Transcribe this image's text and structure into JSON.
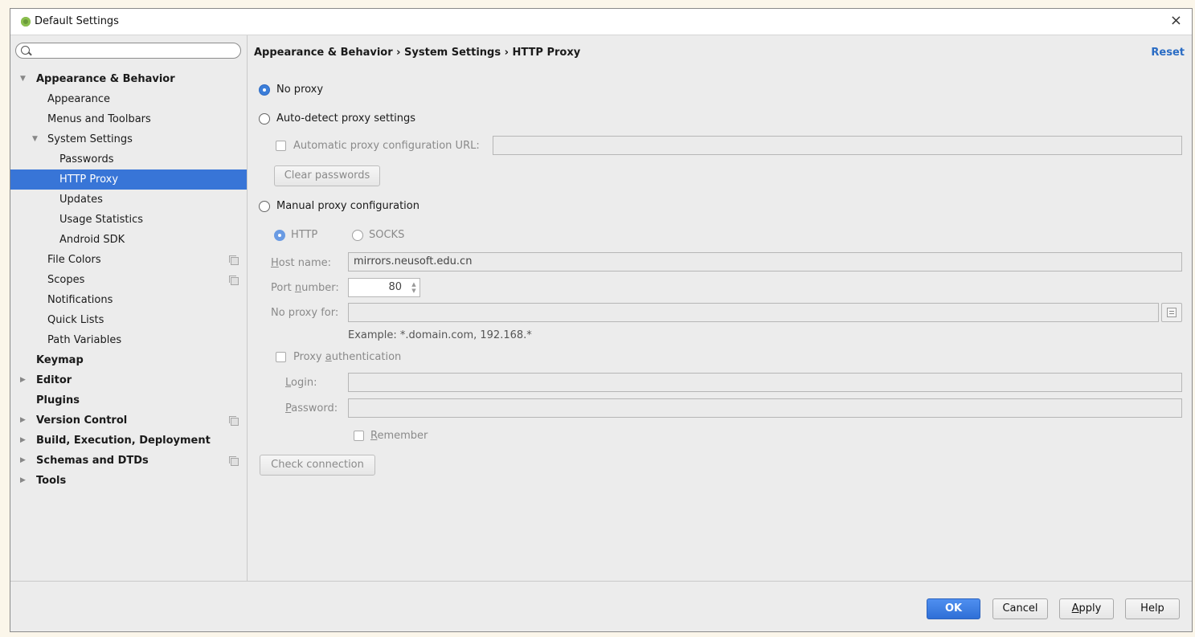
{
  "window": {
    "title": "Default Settings",
    "close_label": "×"
  },
  "search": {
    "placeholder": "",
    "value": ""
  },
  "tree": [
    {
      "label": "Appearance & Behavior",
      "level": 0,
      "expanded": true,
      "bold": true
    },
    {
      "label": "Appearance",
      "level": 1
    },
    {
      "label": "Menus and Toolbars",
      "level": 1
    },
    {
      "label": "System Settings",
      "level": 1,
      "expanded": true
    },
    {
      "label": "Passwords",
      "level": 2
    },
    {
      "label": "HTTP Proxy",
      "level": 2,
      "selected": true
    },
    {
      "label": "Updates",
      "level": 2
    },
    {
      "label": "Usage Statistics",
      "level": 2
    },
    {
      "label": "Android SDK",
      "level": 2
    },
    {
      "label": "File Colors",
      "level": 1,
      "copy": true
    },
    {
      "label": "Scopes",
      "level": 1,
      "copy": true
    },
    {
      "label": "Notifications",
      "level": 1
    },
    {
      "label": "Quick Lists",
      "level": 1
    },
    {
      "label": "Path Variables",
      "level": 1
    },
    {
      "label": "Keymap",
      "level": 0,
      "bold": true
    },
    {
      "label": "Editor",
      "level": 0,
      "bold": true,
      "collapsed": true
    },
    {
      "label": "Plugins",
      "level": 0,
      "bold": true
    },
    {
      "label": "Version Control",
      "level": 0,
      "bold": true,
      "collapsed": true,
      "copy": true
    },
    {
      "label": "Build, Execution, Deployment",
      "level": 0,
      "bold": true,
      "collapsed": true
    },
    {
      "label": "Schemas and DTDs",
      "level": 0,
      "bold": true,
      "collapsed": true,
      "copy": true
    },
    {
      "label": "Tools",
      "level": 0,
      "bold": true,
      "collapsed": true
    }
  ],
  "content": {
    "breadcrumb": "Appearance & Behavior › System Settings › HTTP Proxy",
    "reset_label": "Reset",
    "no_proxy": "No proxy",
    "auto_detect": "Auto-detect proxy settings",
    "auto_config_url": "Automatic proxy configuration URL:",
    "auto_config_value": "",
    "clear_passwords": "Clear passwords",
    "manual": "Manual proxy configuration",
    "http": "HTTP",
    "socks": "SOCKS",
    "host_label_pre": "",
    "host_label_u": "H",
    "host_label_post": "ost name:",
    "host_value": "mirrors.neusoft.edu.cn",
    "port_label_pre": "Port ",
    "port_label_u": "n",
    "port_label_post": "umber:",
    "port_value": "80",
    "no_proxy_for_label": "No proxy for:",
    "no_proxy_for_value": "",
    "example": "Example: *.domain.com, 192.168.*",
    "proxy_auth_pre": "Proxy ",
    "proxy_auth_u": "a",
    "proxy_auth_post": "uthentication",
    "login_u": "L",
    "login_post": "ogin:",
    "login_value": "",
    "password_u": "P",
    "password_post": "assword:",
    "password_value": "",
    "remember_u": "R",
    "remember_post": "emember",
    "check_connection": "Check connection"
  },
  "footer": {
    "ok": "OK",
    "cancel": "Cancel",
    "apply_u": "A",
    "apply_post": "pply",
    "help": "Help"
  },
  "colors": {
    "accent": "#3875d7",
    "link": "#2a6cc4"
  }
}
